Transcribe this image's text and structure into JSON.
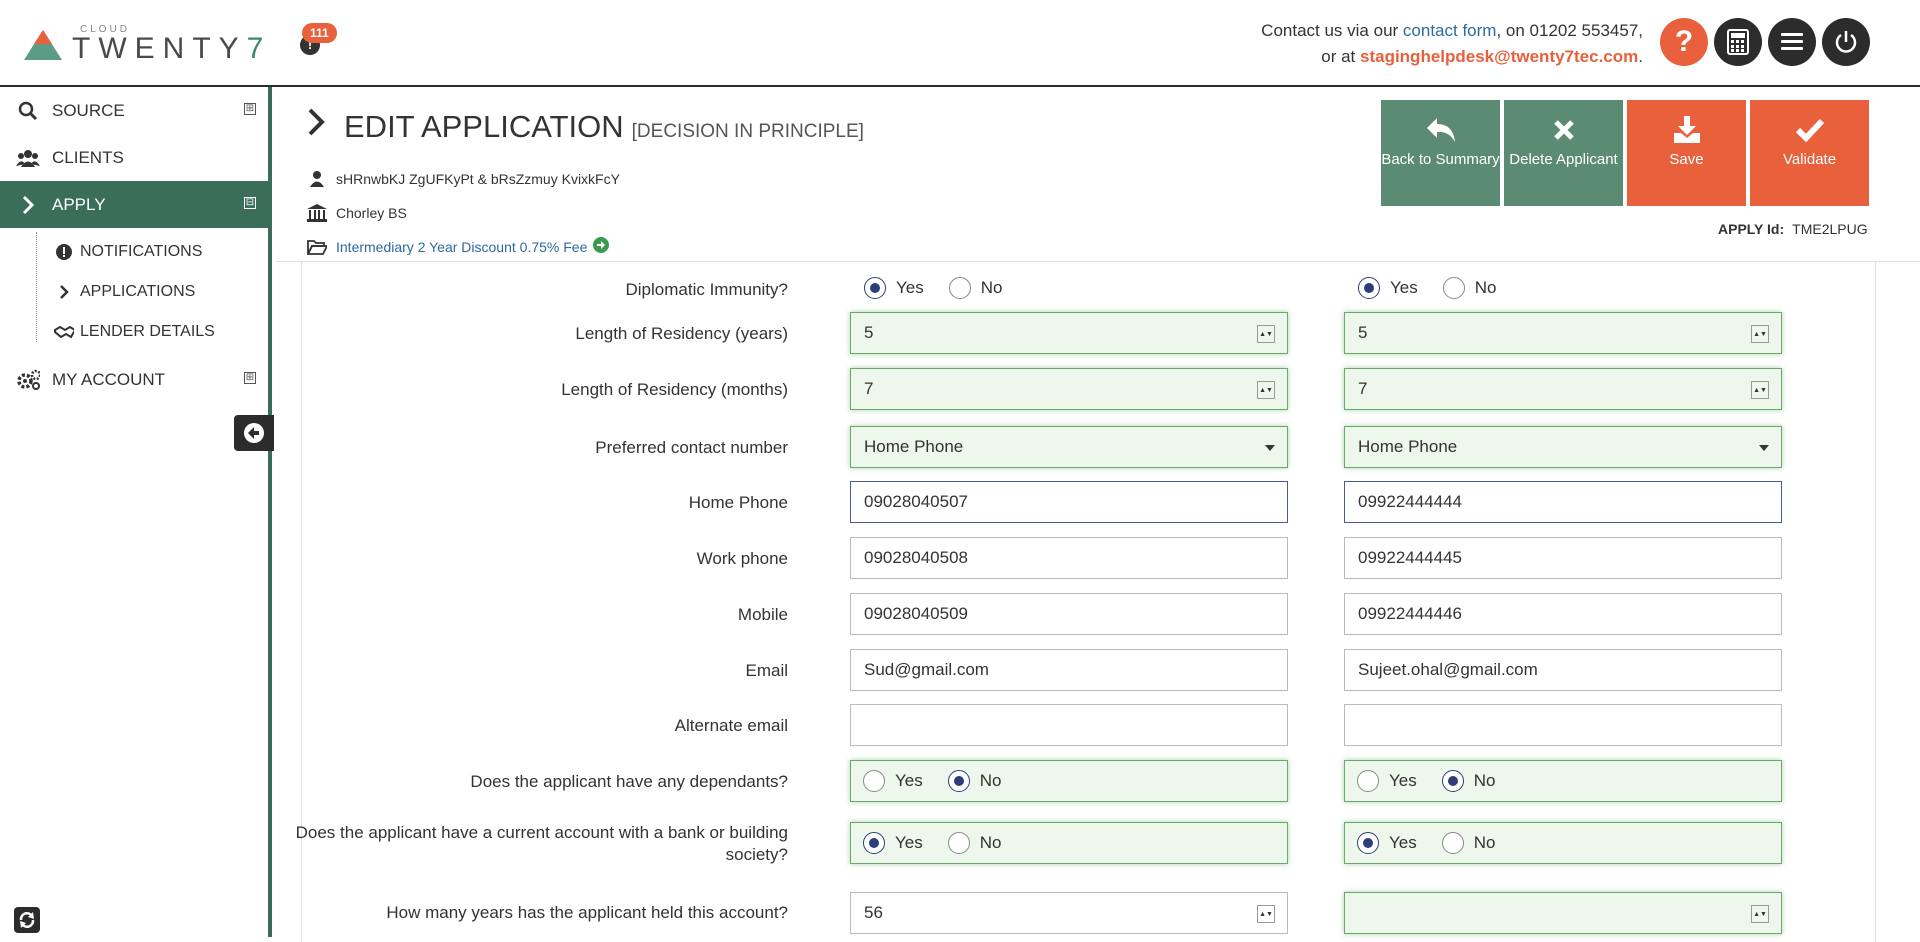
{
  "header": {
    "logo_small": "CLOUD",
    "logo_main": "TWENTY",
    "logo_seven": "7",
    "notification_count": "111",
    "contact_prefix": "Contact us via our ",
    "contact_link": "contact form",
    "contact_phone": ", on 01202 553457,",
    "contact_or": "or at ",
    "contact_email": "staginghelpdesk@twenty7tec.com",
    "contact_end": ".",
    "help_label": "?"
  },
  "sidebar": {
    "items": [
      {
        "label": "SOURCE"
      },
      {
        "label": "CLIENTS"
      },
      {
        "label": "APPLY"
      },
      {
        "label": "MY ACCOUNT"
      }
    ],
    "sub_items": [
      {
        "label": "NOTIFICATIONS"
      },
      {
        "label": "APPLICATIONS"
      },
      {
        "label": "LENDER DETAILS"
      }
    ],
    "expand_symbol": "⊞",
    "collapse_symbol": "⊟"
  },
  "page": {
    "title": "EDIT APPLICATION",
    "subtitle": "[DECISION IN PRINCIPLE]",
    "applicants": "sHRnwbKJ ZgUFKyPt & bRsZzmuy KvixkFcY",
    "lender": "Chorley BS",
    "product": "Intermediary 2 Year Discount 0.75% Fee",
    "apply_id_label": "APPLY Id:",
    "apply_id_value": "TME2LPUG"
  },
  "actions": {
    "back": "Back to Summary",
    "delete": "Delete Applicant",
    "save": "Save",
    "validate": "Validate"
  },
  "form": {
    "yes": "Yes",
    "no": "No",
    "labels": {
      "diplomatic": "Diplomatic Immunity?",
      "res_years": "Length of Residency (years)",
      "res_months": "Length of Residency (months)",
      "pref_contact": "Preferred contact number",
      "home_phone": "Home Phone",
      "work_phone": "Work phone",
      "mobile": "Mobile",
      "email": "Email",
      "alt_email": "Alternate email",
      "dependants": "Does the applicant have any dependants?",
      "current_account": "Does the applicant have a current account with a bank or building society?",
      "years_held": "How many years has the applicant held this account?"
    },
    "applicant1": {
      "diplomatic": "yes",
      "res_years": "5",
      "res_months": "7",
      "pref_contact": "Home Phone",
      "home_phone": "09028040507",
      "work_phone": "09028040508",
      "mobile": "09028040509",
      "email": "Sud@gmail.com",
      "alt_email": "",
      "dependants": "no",
      "current_account": "yes",
      "years_held": "56"
    },
    "applicant2": {
      "diplomatic": "yes",
      "res_years": "5",
      "res_months": "7",
      "pref_contact": "Home Phone",
      "home_phone": "09922444444",
      "work_phone": "09922444445",
      "mobile": "09922444446",
      "email": "Sujeet.ohal@gmail.com",
      "alt_email": "",
      "dependants": "no",
      "current_account": "yes",
      "years_held": ""
    }
  },
  "colors": {
    "sidebar_active": "#3b6e58",
    "accent_orange": "#e8603c",
    "action_green": "#5c8b74",
    "link_blue": "#2d6aa0",
    "radio_selected": "#2c3e7a"
  }
}
